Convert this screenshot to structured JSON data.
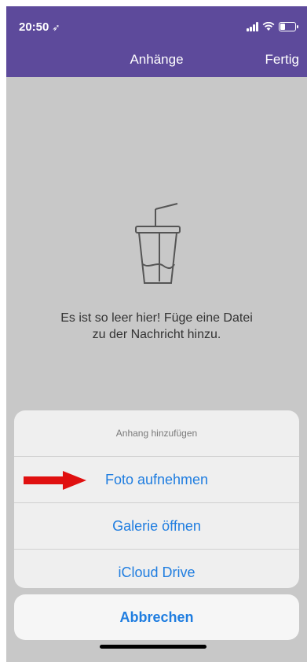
{
  "status_bar": {
    "time": "20:50",
    "location_glyph": "➶"
  },
  "nav": {
    "title": "Anhänge",
    "done_label": "Fertig"
  },
  "empty_state": {
    "icon": "cup-with-straw-icon",
    "line1": "Es ist so leer hier! Füge eine Datei",
    "line2": "zu der Nachricht hinzu."
  },
  "action_sheet": {
    "title": "Anhang hinzufügen",
    "options": [
      "Foto aufnehmen",
      "Galerie öffnen",
      "iCloud Drive"
    ],
    "cancel_label": "Abbrechen"
  },
  "colors": {
    "nav_bg": "#5d4a9b",
    "accent": "#1f7de0",
    "arrow": "#e01010"
  }
}
